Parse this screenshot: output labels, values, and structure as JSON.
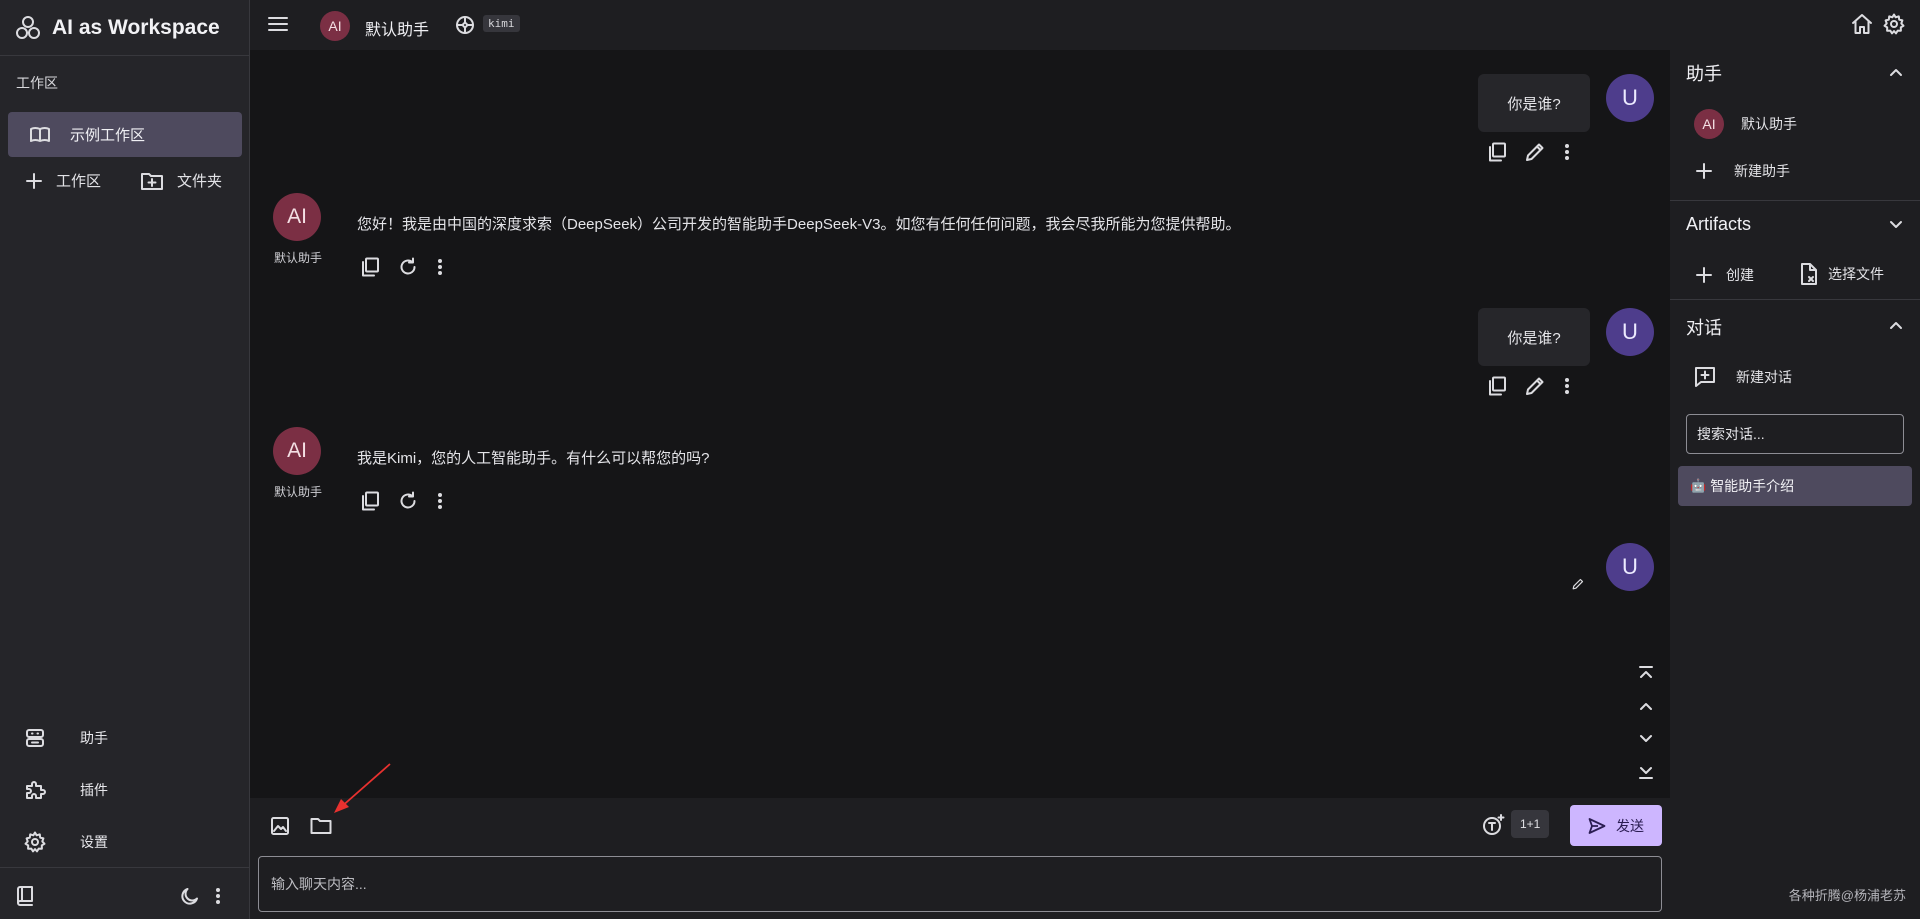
{
  "app": {
    "title": "AI as Workspace"
  },
  "left_sidebar": {
    "workspace_label": "工作区",
    "active_workspace": "示例工作区",
    "add_workspace_label": "工作区",
    "add_folder_label": "文件夹",
    "nav": [
      {
        "label": "助手",
        "icon": "robot-icon"
      },
      {
        "label": "插件",
        "icon": "puzzle-icon"
      },
      {
        "label": "设置",
        "icon": "gear-icon"
      }
    ]
  },
  "header": {
    "assistant_avatar": "AI",
    "assistant_name": "默认助手",
    "model_tag": "kimi"
  },
  "chat": {
    "user_avatar": "U",
    "messages": [
      {
        "role": "user",
        "text": "你是谁?"
      },
      {
        "role": "assistant",
        "avatar": "AI",
        "name": "默认助手",
        "text": "您好！我是由中国的深度求索（DeepSeek）公司开发的智能助手DeepSeek-V3。如您有任何任何问题，我会尽我所能为您提供帮助。"
      },
      {
        "role": "user",
        "text": "你是谁?"
      },
      {
        "role": "assistant",
        "avatar": "AI",
        "name": "默认助手",
        "text": "我是Kimi，您的人工智能助手。有什么可以帮您的吗?"
      },
      {
        "role": "user",
        "text": ""
      }
    ]
  },
  "input": {
    "template_tag": "1+1",
    "send_label": "发送",
    "placeholder": "输入聊天内容..."
  },
  "right_sidebar": {
    "assistant_section": {
      "title": "助手",
      "item_avatar": "AI",
      "item_label": "默认助手",
      "new_label": "新建助手"
    },
    "artifacts_section": {
      "title": "Artifacts",
      "create_label": "创建",
      "select_file_label": "选择文件"
    },
    "conversation_section": {
      "title": "对话",
      "new_label": "新建对话",
      "search_placeholder": "搜索对话...",
      "items": [
        {
          "emoji": "🤖",
          "title": "智能助手介绍"
        }
      ]
    },
    "footer_note": "各种折腾@杨浦老苏"
  },
  "colors": {
    "accent": "#cdb6ff",
    "ai_avatar": "#7b2f44",
    "user_avatar": "#4e3d8c",
    "selected": "#4e4a5e"
  }
}
